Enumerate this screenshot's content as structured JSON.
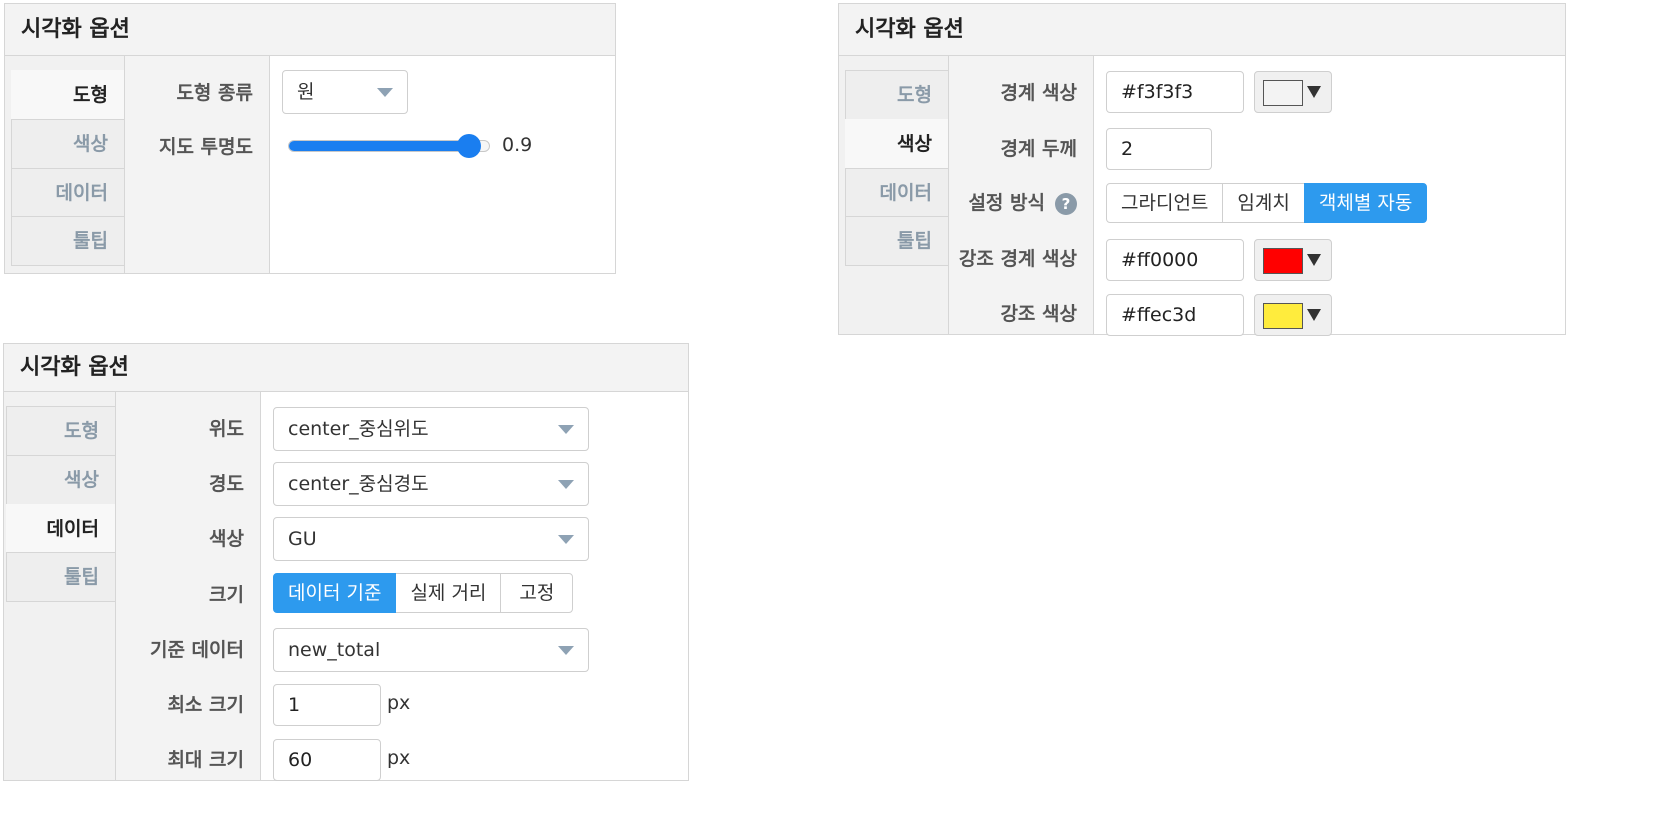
{
  "panel1": {
    "title": "시각화 옵션",
    "tabs": [
      "도형",
      "색상",
      "데이터",
      "툴팁"
    ],
    "shape_type_label": "도형 종류",
    "shape_type_value": "원",
    "opacity_label": "지도 투명도",
    "opacity_value": 0.9,
    "opacity_text": "0.9"
  },
  "panel2": {
    "title": "시각화 옵션",
    "tabs": [
      "도형",
      "색상",
      "데이터",
      "툴팁"
    ],
    "border_color_label": "경계 색상",
    "border_color_value": "#f3f3f3",
    "border_width_label": "경계 두께",
    "border_width_value": "2",
    "method_label": "설정 방식",
    "help_glyph": "?",
    "method_options": [
      "그라디언트",
      "임계치",
      "객체별 자동"
    ],
    "highlight_border_label": "강조 경계 색상",
    "highlight_border_value": "#ff0000",
    "highlight_color_label": "강조 색상",
    "highlight_color_value": "#ffec3d"
  },
  "panel3": {
    "title": "시각화 옵션",
    "tabs": [
      "도형",
      "색상",
      "데이터",
      "툴팁"
    ],
    "lat_label": "위도",
    "lat_value": "center_중심위도",
    "lng_label": "경도",
    "lng_value": "center_중심경도",
    "color_label": "색상",
    "color_value": "GU",
    "size_label": "크기",
    "size_options": [
      "데이터 기준",
      "실제 거리",
      "고정"
    ],
    "base_data_label": "기준 데이터",
    "base_data_value": "new_total",
    "min_size_label": "최소 크기",
    "min_size_value": "1",
    "max_size_label": "최대 크기",
    "max_size_value": "60",
    "unit": "px"
  },
  "colors": {
    "accent": "#2d9aee",
    "slider": "#1a7ef0",
    "tab_inactive_text": "#8a9aa8",
    "swatch_border": "#f3f3f3",
    "swatch_highlight_border": "#ff0000",
    "swatch_highlight": "#ffec3d"
  },
  "icons": {
    "dropdown": "chevron-down-icon",
    "help": "question-circle-icon",
    "color_dropdown": "triangle-down-icon"
  }
}
